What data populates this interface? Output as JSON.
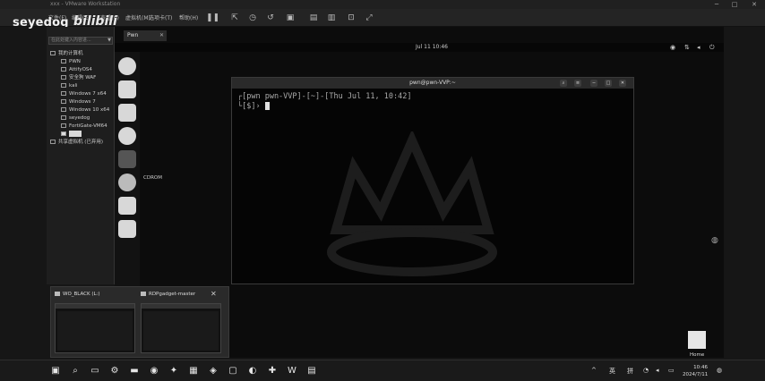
{
  "host": {
    "title": "xxx - VMware Workstation",
    "menu": [
      "文件(F)",
      "编辑(E)",
      "查看(V)",
      "虚拟机(M)",
      "选项卡(T)",
      "帮助(H)"
    ],
    "watermark_user": "seyedog",
    "watermark_logo": "bilibili"
  },
  "library": {
    "search_placeholder": "在此处键入内容进...",
    "root": "我的计算机",
    "vms": [
      "PWN",
      "AttifyOS4",
      "安全狗 WAF",
      "kali",
      "Windows 7 x64",
      "Windows 7",
      "Windows 10 x64",
      "seyedog",
      "FortiGate-VM64"
    ],
    "shared": "共享虚拟机 (已弃用)"
  },
  "guest": {
    "tab_label": "Pwn",
    "clock": "Jul 11  10:46",
    "dock_label": "CDROM"
  },
  "terminal": {
    "title": "pwn@pwn-VVP:~",
    "line1": "┌[pwn pwn-VVP]-[~]-[Thu Jul 11, 10:42]",
    "line2": "└[$]› "
  },
  "desktop": {
    "home_label": "Home"
  },
  "thumbnails": [
    {
      "title": "WO_BLACK (L:)"
    },
    {
      "title": "RDPgadget-master"
    }
  ],
  "taskbar": {
    "time": "10:46",
    "date": "2024/7/11",
    "ime": "英",
    "ime2": "拼"
  },
  "colors": {
    "background": "#0c0c0c",
    "accent": "#e0e0e0"
  }
}
